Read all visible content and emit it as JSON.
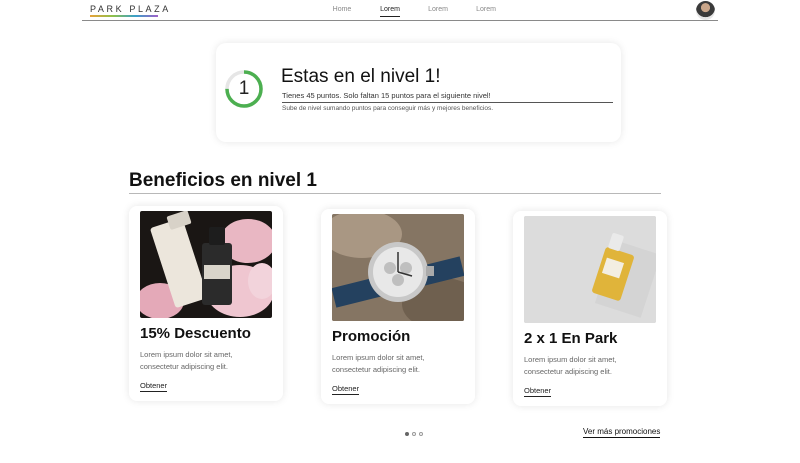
{
  "header": {
    "logo": "PARK PLAZA",
    "nav": [
      "Home",
      "Lorem",
      "Lorem",
      "Lorem"
    ],
    "active_nav_index": 1
  },
  "level": {
    "number": "1",
    "progress": 0.75,
    "title": "Estas en el nivel 1!",
    "points_text": "Tienes 45 puntos. Solo faltan 15 puntos para el siguiente nivel!",
    "description": "Sube de nivel sumando puntos para conseguir más y mejores beneficios."
  },
  "benefits": {
    "heading": "Beneficios en nivel 1",
    "cards": [
      {
        "title": "15% Descuento",
        "desc_line1": "Lorem ipsum dolor sit amet,",
        "desc_line2": "consectetur adipiscing elit.",
        "link": "Obtener",
        "image": "skincare-bottles-image"
      },
      {
        "title": "Promoción",
        "desc_line1": "Lorem ipsum dolor sit amet,",
        "desc_line2": "consectetur adipiscing elit.",
        "link": "Obtener",
        "image": "watch-image"
      },
      {
        "title": "2 x 1 En Park",
        "desc_line1": "Lorem ipsum dolor sit amet,",
        "desc_line2": "consectetur adipiscing elit.",
        "link": "Obtener",
        "image": "perfume-bottle-image"
      }
    ]
  },
  "pagination": {
    "count": 3,
    "active": 0
  },
  "more_link": "Ver más promociones",
  "colors": {
    "progress_ring": "#4caf50",
    "progress_track": "#e6e6e6",
    "text": "#111111"
  }
}
